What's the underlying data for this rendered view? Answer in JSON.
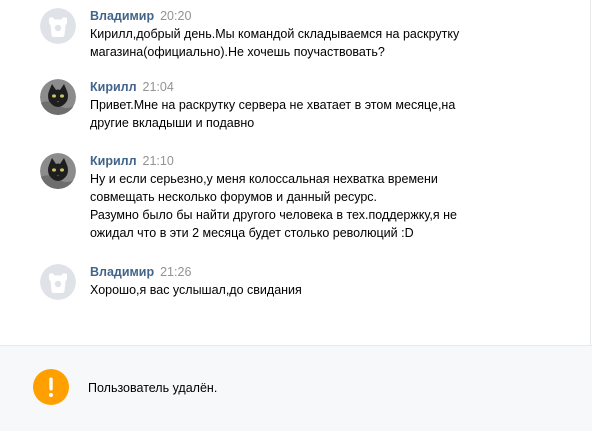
{
  "messages": [
    {
      "sender": "Владимир",
      "time": "20:20",
      "avatar_icon": "vk-camera-avatar-icon",
      "lines": [
        "Кирилл,добрый день.Мы командой складываемся на раскрутку",
        "магазина(официально).Не хочешь поучаствовать?"
      ]
    },
    {
      "sender": "Кирилл",
      "time": "21:04",
      "avatar_icon": "cat-avatar-icon",
      "lines": [
        "Привет.Мне на раскрутку сервера не хватает в этом месяце,на",
        "другие вкладыши и подавно"
      ]
    },
    {
      "sender": "Кирилл",
      "time": "21:10",
      "avatar_icon": "cat-avatar-icon",
      "lines": [
        "Ну и если серьезно,у меня колоссальная нехватка времени",
        "совмещать несколько форумов и данный ресурс.",
        "Разумно было бы найти другого человека в тех.поддержку,я не",
        "ожидал что в эти 2 месяца будет столько революций :D"
      ]
    },
    {
      "sender": "Владимир",
      "time": "21:26",
      "avatar_icon": "vk-camera-avatar-icon",
      "lines": [
        "Хорошо,я вас услышал,до свидания"
      ]
    }
  ],
  "footer": {
    "notice": "Пользователь удалён.",
    "icon": "exclamation-warning-icon"
  },
  "colors": {
    "name": "#42648b",
    "time": "#939393",
    "warning": "#ffa000",
    "footer_bg": "#f7f8fa",
    "avatar_default_bg": "#dfe3e8"
  }
}
